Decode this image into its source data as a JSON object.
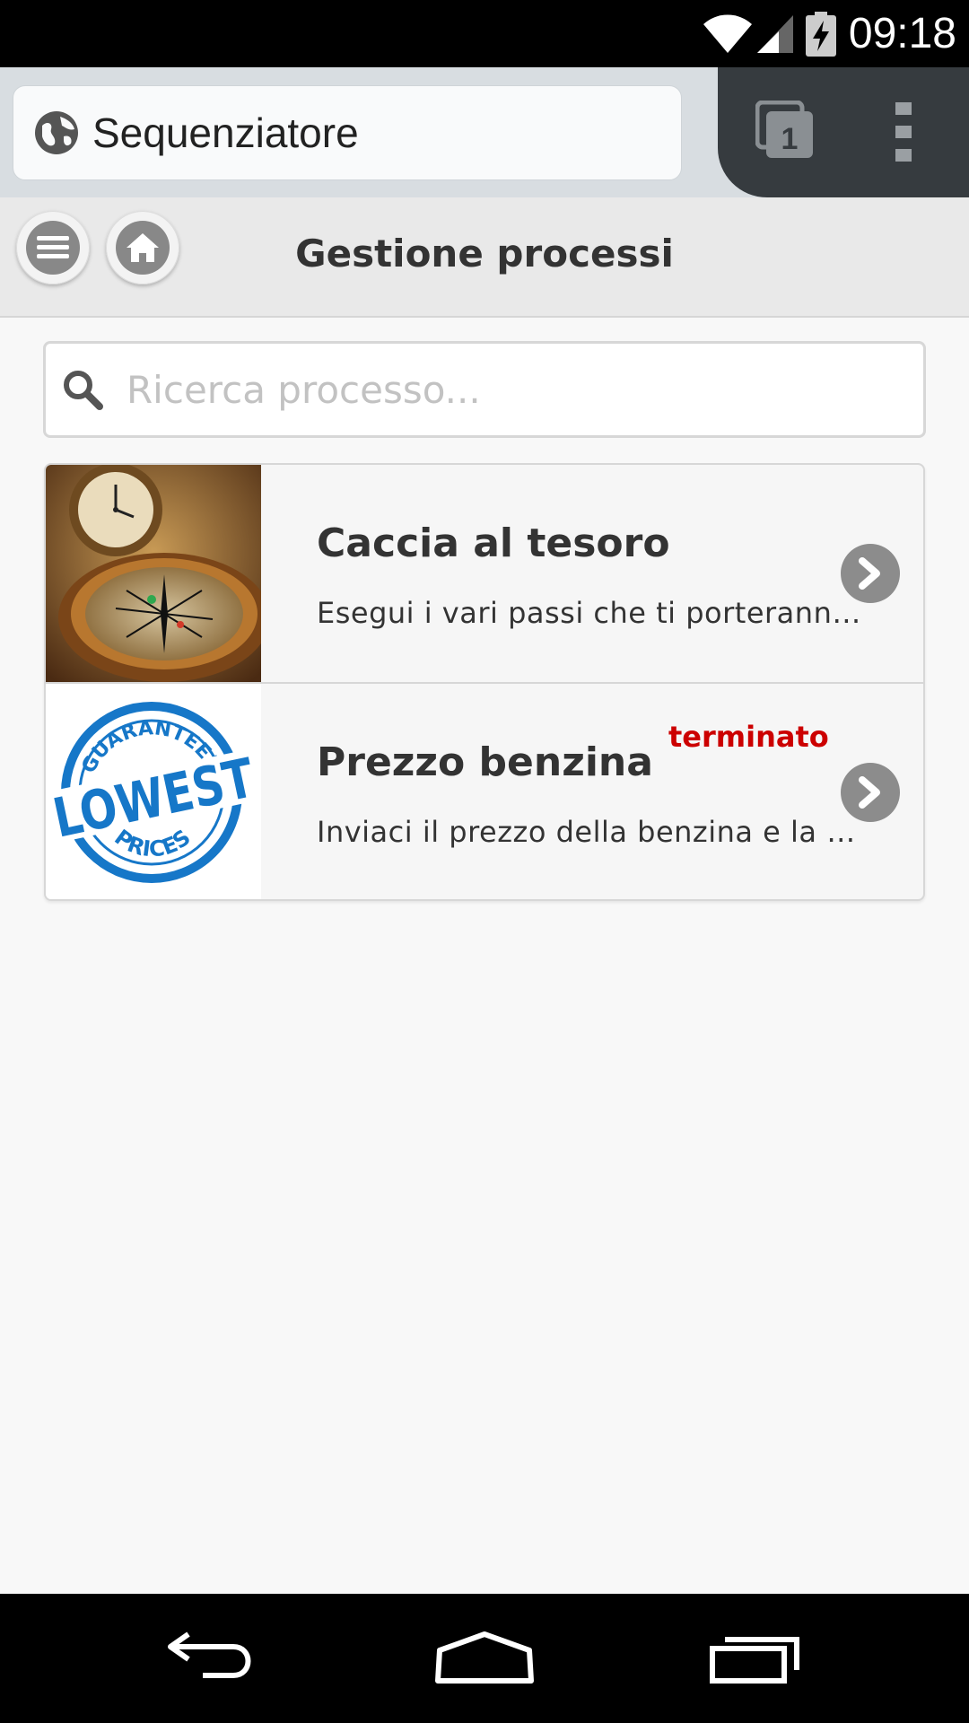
{
  "status_bar": {
    "time": "09:18",
    "icons": [
      "wifi-icon",
      "signal-icon",
      "battery-charging-icon"
    ]
  },
  "browser": {
    "url_text": "Sequenziatore",
    "tab_count": "1",
    "icons": [
      "globe-icon",
      "tabs-icon",
      "overflow-menu-icon"
    ]
  },
  "header": {
    "title": "Gestione processi",
    "buttons": [
      "menu-icon",
      "home-icon"
    ]
  },
  "search": {
    "placeholder": "Ricerca processo...",
    "value": ""
  },
  "processes": [
    {
      "title": "Caccia al tesoro",
      "description": "Esegui i vari passi che ti porteranno al tesoro",
      "status": "",
      "image": "compass-clock-image"
    },
    {
      "title": "Prezzo benzina",
      "description": "Inviaci il prezzo della benzina e la tua posizione",
      "status": "terminato",
      "image": "lowest-prices-stamp-image",
      "stamp_text": {
        "top": "GUARANTEED",
        "middle": "LOWEST",
        "bottom": "PRICES"
      }
    }
  ],
  "colors": {
    "status_terminated": "#cc0000",
    "stamp_blue": "#1677c8",
    "chevron_bg": "#8c8c8c"
  }
}
